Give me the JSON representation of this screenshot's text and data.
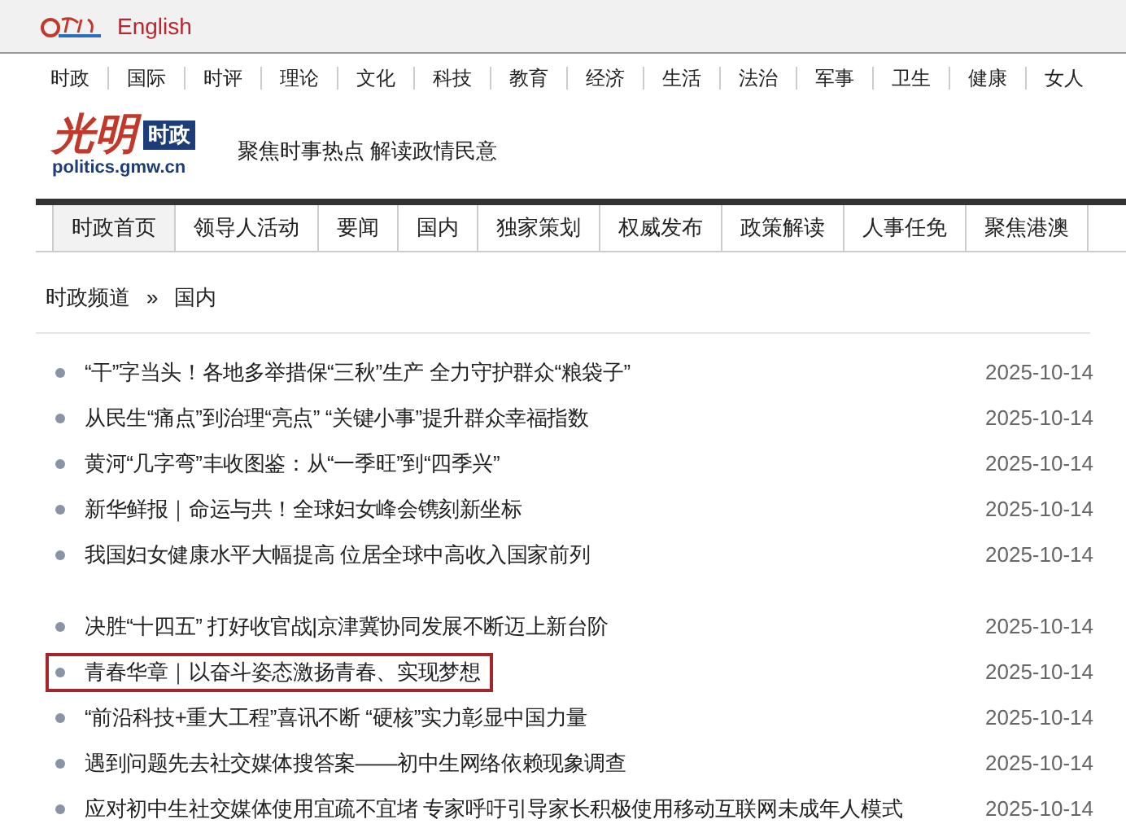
{
  "top_bar": {
    "language_link": "English"
  },
  "channels": [
    "时政",
    "国际",
    "时评",
    "理论",
    "文化",
    "科技",
    "教育",
    "经济",
    "生活",
    "法治",
    "军事",
    "卫生",
    "健康",
    "女人"
  ],
  "header": {
    "logo_text": "光明",
    "logo_badge": "时政",
    "logo_domain": "politics.gmw.cn",
    "slogan": "聚焦时事热点 解读政情民意"
  },
  "tabs": [
    {
      "label": "时政首页",
      "selected": true
    },
    {
      "label": "领导人活动",
      "selected": false
    },
    {
      "label": "要闻",
      "selected": false
    },
    {
      "label": "国内",
      "selected": false
    },
    {
      "label": "独家策划",
      "selected": false
    },
    {
      "label": "权威发布",
      "selected": false
    },
    {
      "label": "政策解读",
      "selected": false
    },
    {
      "label": "人事任免",
      "selected": false
    },
    {
      "label": "聚焦港澳",
      "selected": false
    }
  ],
  "breadcrumb": {
    "items": [
      "时政频道",
      "国内"
    ],
    "separator": "»"
  },
  "news_groups": [
    {
      "items": [
        {
          "title": "“干”字当头！各地多举措保“三秋”生产 全力守护群众“粮袋子”",
          "date": "2025-10-14",
          "highlighted": false
        },
        {
          "title": "从民生“痛点”到治理“亮点”  “关键小事”提升群众幸福指数",
          "date": "2025-10-14",
          "highlighted": false
        },
        {
          "title": "黄河“几字弯”丰收图鉴：从“一季旺”到“四季兴”",
          "date": "2025-10-14",
          "highlighted": false
        },
        {
          "title": "新华鲜报｜命运与共！全球妇女峰会镌刻新坐标",
          "date": "2025-10-14",
          "highlighted": false
        },
        {
          "title": "我国妇女健康水平大幅提高 位居全球中高收入国家前列",
          "date": "2025-10-14",
          "highlighted": false
        }
      ]
    },
    {
      "items": [
        {
          "title": "决胜“十四五” 打好收官战|京津冀协同发展不断迈上新台阶",
          "date": "2025-10-14",
          "highlighted": false
        },
        {
          "title": "青春华章｜以奋斗姿态激扬青春、实现梦想",
          "date": "2025-10-14",
          "highlighted": true
        },
        {
          "title": "“前沿科技+重大工程”喜讯不断 “硬核”实力彰显中国力量",
          "date": "2025-10-14",
          "highlighted": false
        },
        {
          "title": "遇到问题先去社交媒体搜答案——初中生网络依赖现象调查",
          "date": "2025-10-14",
          "highlighted": false
        },
        {
          "title": "应对初中生社交媒体使用宜疏不宜堵 专家呼吁引导家长积极使用移动互联网未成年人模式",
          "date": "2025-10-14",
          "highlighted": false
        }
      ]
    }
  ]
}
